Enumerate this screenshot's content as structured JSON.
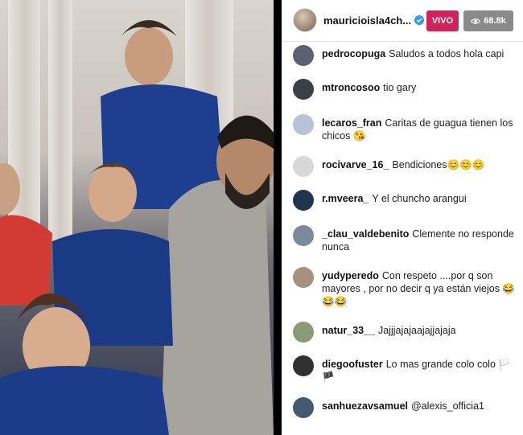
{
  "header": {
    "username": "mauricioisla4ch...",
    "live_label": "VIVO",
    "viewers": "68.8k"
  },
  "comments": [
    {
      "user": "pedrocopuga",
      "text": "Saludos a todos hola capi",
      "avatar_color": "#5c6070"
    },
    {
      "user": "mtroncosoo",
      "text": "tio gary",
      "avatar_color": "#3a3f48"
    },
    {
      "user": "lecaros_fran",
      "text": "Caritas de guagua tienen los chicos 😘",
      "avatar_color": "#b8c3d8"
    },
    {
      "user": "rocivarve_16_",
      "text": "Bendiciones😊😊😊",
      "avatar_color": "#d8d8d8"
    },
    {
      "user": "r.mveera_",
      "text": "Y el chuncho arangui",
      "avatar_color": "#1f3550"
    },
    {
      "user": "_clau_valdebenito",
      "text": "Clemente no responde nunca",
      "avatar_color": "#7a8a9a"
    },
    {
      "user": "yudyperedo",
      "text": "Con respeto ....por q son mayores , por no decir q ya están viejos 😂😂😂",
      "avatar_color": "#a89080"
    },
    {
      "user": "natur_33__",
      "text": "Jajjjajajaajajjajaja",
      "avatar_color": "#8a9a78"
    },
    {
      "user": "diegoofuster",
      "text": "Lo mas grande colo colo 🏳️🏴",
      "avatar_color": "#303030"
    },
    {
      "user": "sanhuezavsamuel",
      "text": "@alexis_officia1",
      "avatar_color": "#445a70"
    }
  ],
  "colors": {
    "live": "#d1235a",
    "viewers_bg": "#8a8a8a",
    "verified": "#3897f0"
  }
}
